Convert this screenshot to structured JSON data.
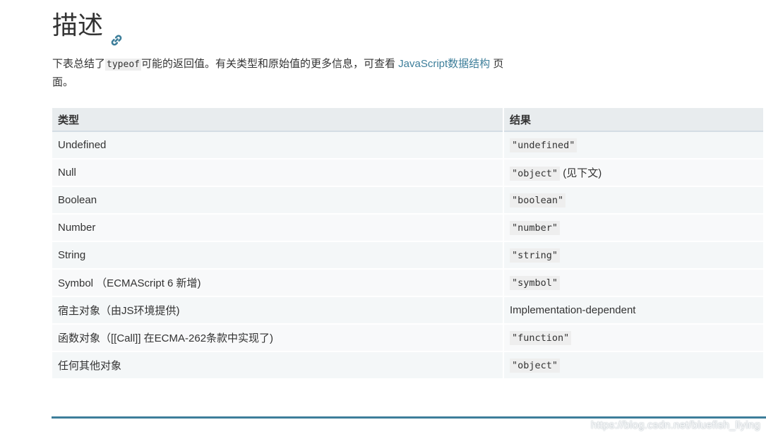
{
  "heading": {
    "title": "描述",
    "anchor_icon": "link-icon"
  },
  "intro": {
    "prefix": "下表总结了",
    "code": "typeof",
    "middle": "可能的返回值。有关类型和原始值的更多信息，可查看 ",
    "link_text": "JavaScript数据结构",
    "suffix": " 页面。"
  },
  "table": {
    "headers": [
      "类型",
      "结果"
    ],
    "rows": [
      {
        "type": "Undefined",
        "result_code": "\"undefined\"",
        "result_text": ""
      },
      {
        "type": "Null",
        "result_code": "\"object\"",
        "result_text": " (见下文)"
      },
      {
        "type": "Boolean",
        "result_code": "\"boolean\"",
        "result_text": ""
      },
      {
        "type": "Number",
        "result_code": "\"number\"",
        "result_text": ""
      },
      {
        "type": "String",
        "result_code": "\"string\"",
        "result_text": ""
      },
      {
        "type": "Symbol （ECMAScript 6 新增)",
        "result_code": "\"symbol\"",
        "result_text": ""
      },
      {
        "type": "宿主对象（由JS环境提供)",
        "result_code": "",
        "result_text": "Implementation-dependent"
      },
      {
        "type": "函数对象（[[Call]] 在ECMA-262条款中实现了)",
        "result_code": "\"function\"",
        "result_text": ""
      },
      {
        "type": "任何其他对象",
        "result_code": "\"object\"",
        "result_text": ""
      }
    ]
  },
  "watermark": "https://blog.csdn.net/bluefish_liying",
  "colors": {
    "link": "#3d7e9a",
    "header_bg": "#e8ecee",
    "row_bg": "#f4f7f8",
    "code_bg": "#eeeeee"
  }
}
